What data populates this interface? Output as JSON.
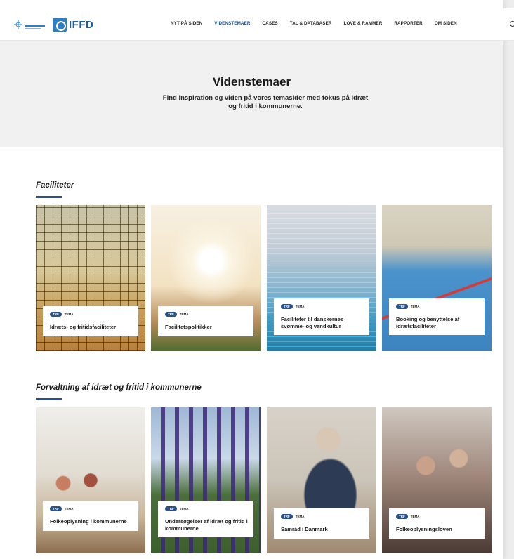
{
  "header": {
    "logo_primary": "Idrættens Analyseinstitut",
    "logo_secondary": "IFFD",
    "nav": [
      {
        "label": "NYT PÅ SIDEN",
        "active": false
      },
      {
        "label": "VIDENSTEMAER",
        "active": true
      },
      {
        "label": "CASES",
        "active": false
      },
      {
        "label": "TAL & DATABASER",
        "active": false
      },
      {
        "label": "LOVE & RAMMER",
        "active": false
      },
      {
        "label": "RAPPORTER",
        "active": false
      },
      {
        "label": "OM SIDEN",
        "active": false
      }
    ]
  },
  "hero": {
    "title": "Videnstemaer",
    "subtitle": "Find inspiration og viden på vores temasider med fokus på idræt og fritid i kommunerne."
  },
  "sections": [
    {
      "title": "Faciliteter",
      "cards": [
        {
          "badge": "TRF",
          "tag": "TEMA",
          "title": "Idræts- og fritidsfaciliteter"
        },
        {
          "badge": "TRF",
          "tag": "TEMA",
          "title": "Facilitetspolitikker"
        },
        {
          "badge": "TRF",
          "tag": "TEMA",
          "title": "Faciliteter til danskernes svømme- og vandkultur"
        },
        {
          "badge": "TRF",
          "tag": "TEMA",
          "title": "Booking og benyttelse af idrætsfaciliteter"
        }
      ]
    },
    {
      "title": "Forvaltning af idræt og fritid i kommunerne",
      "cards": [
        {
          "badge": "TRF",
          "tag": "TEMA",
          "title": "Folkeoplysning i kommunerne"
        },
        {
          "badge": "TRF",
          "tag": "TEMA",
          "title": "Undersøgelser af idræt og fritid i kommunerne"
        },
        {
          "badge": "TRF",
          "tag": "TEMA",
          "title": "Samråd i Danmark"
        },
        {
          "badge": "TRF",
          "tag": "TEMA",
          "title": "Folkeoplysningsloven"
        }
      ]
    }
  ],
  "colors": {
    "accent": "#2a5289",
    "hero_bg": "#f1f1f1"
  }
}
